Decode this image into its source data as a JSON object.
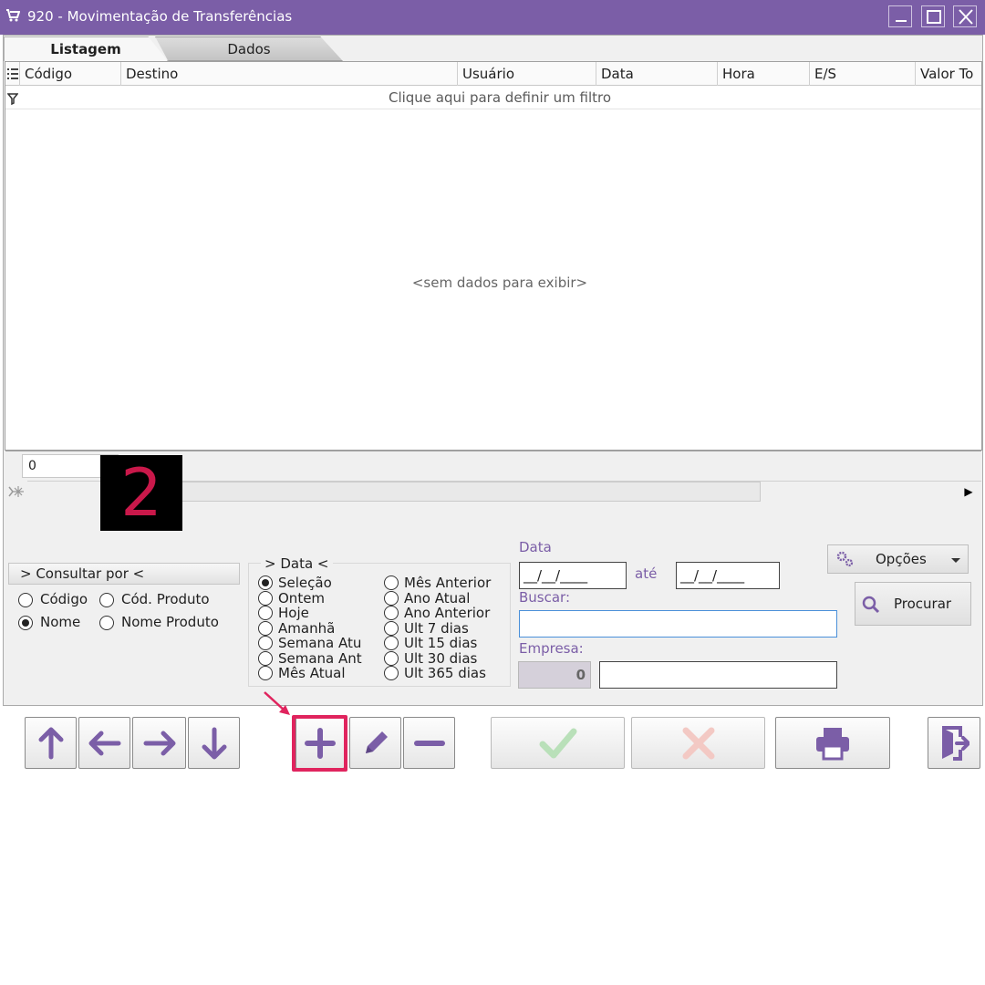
{
  "window": {
    "title": "920 - Movimentação de Transferências"
  },
  "tabs": [
    {
      "label": "Listagem"
    },
    {
      "label": "Dados"
    }
  ],
  "grid": {
    "columns": [
      "Código",
      "Destino",
      "Usuário",
      "Data",
      "Hora",
      "E/S",
      "Valor To"
    ],
    "filter_hint": "Clique aqui para definir um filtro",
    "empty_message": "<sem dados para exibir>",
    "row_count": "0"
  },
  "annotation": {
    "step": "2"
  },
  "consultar": {
    "title": "> Consultar por <",
    "options": [
      "Código",
      "Cód. Produto",
      "Nome",
      "Nome Produto"
    ],
    "selected": "Nome"
  },
  "data_filter": {
    "title": "> Data <",
    "left_options": [
      "Seleção",
      "Ontem",
      "Hoje",
      "Amanhã",
      "Semana Atu",
      "Semana Ant",
      "Mês Atual"
    ],
    "right_options": [
      "Mês Anterior",
      "Ano Atual",
      "Ano Anterior",
      "Ult 7 dias",
      "Ult 15 dias",
      "Ult 30 dias",
      "Ult 365 dias"
    ],
    "selected": "Seleção"
  },
  "fields": {
    "data_label": "Data",
    "date_from": "__/__/____",
    "ate_label": "até",
    "date_to": "__/__/____",
    "buscar_label": "Buscar:",
    "buscar_value": "",
    "empresa_label": "Empresa:",
    "empresa_code": "0",
    "empresa_name": ""
  },
  "buttons": {
    "opcoes": "Opções",
    "procurar": "Procurar"
  },
  "colors": {
    "accent": "#7b5ea7",
    "highlight": "#e0245e",
    "confirm_disabled": "#b9e0b9",
    "cancel_disabled": "#f3c9c4"
  }
}
